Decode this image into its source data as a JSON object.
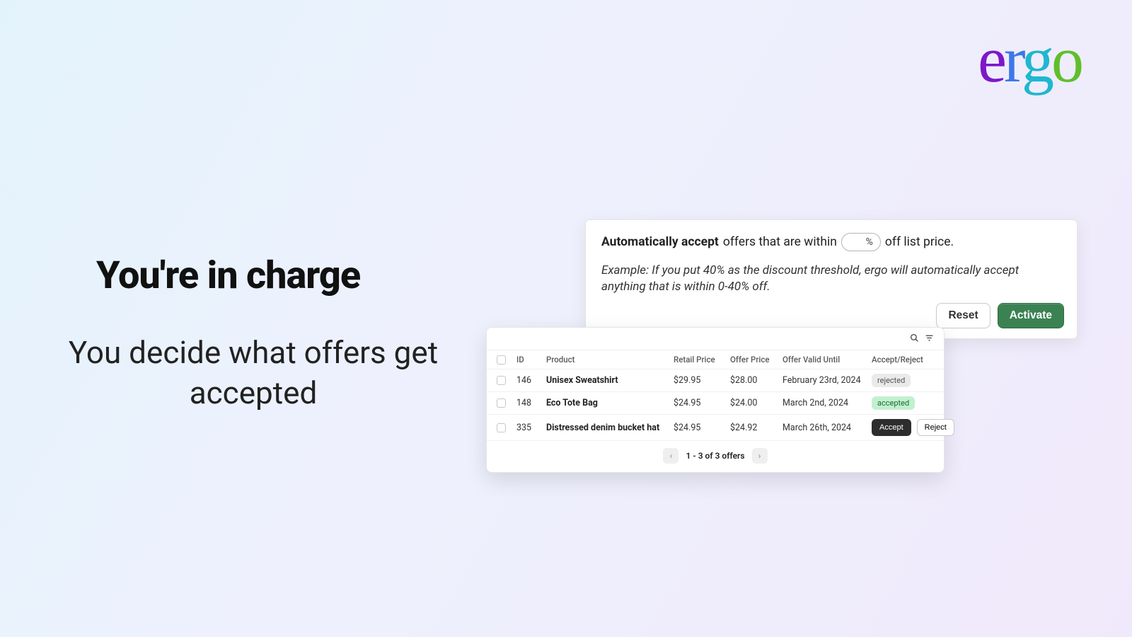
{
  "logo": {
    "l1": "e",
    "l2": "r",
    "l3": "g",
    "l4": "o"
  },
  "heading": "You're in charge",
  "subheading": "You decide what offers get accepted",
  "settings": {
    "auto_bold": "Automatically accept",
    "auto_rest1": "offers that are within",
    "pct_unit": "%",
    "auto_rest2": "off list price.",
    "example": "Example: If you put 40% as the discount threshold, ergo will automatically accept anything that is within 0-40% off.",
    "reset": "Reset",
    "activate": "Activate"
  },
  "table": {
    "headers": {
      "id": "ID",
      "product": "Product",
      "retail": "Retail Price",
      "offer": "Offer Price",
      "valid": "Offer Valid Until",
      "action": "Accept/Reject"
    },
    "rows": [
      {
        "id": "146",
        "product": "Unisex Sweatshirt",
        "retail": "$29.95",
        "offer": "$28.00",
        "valid": "February 23rd, 2024",
        "status": "rejected",
        "status_kind": "chip"
      },
      {
        "id": "148",
        "product": "Eco Tote Bag",
        "retail": "$24.95",
        "offer": "$24.00",
        "valid": "March 2nd, 2024",
        "status": "accepted",
        "status_kind": "chip-accepted"
      },
      {
        "id": "335",
        "product": "Distressed denim bucket hat",
        "retail": "$24.95",
        "offer": "$24.92",
        "valid": "March 26th, 2024",
        "status_kind": "buttons",
        "accept": "Accept",
        "reject": "Reject"
      }
    ],
    "pager_label": "1 - 3 of 3 offers"
  }
}
